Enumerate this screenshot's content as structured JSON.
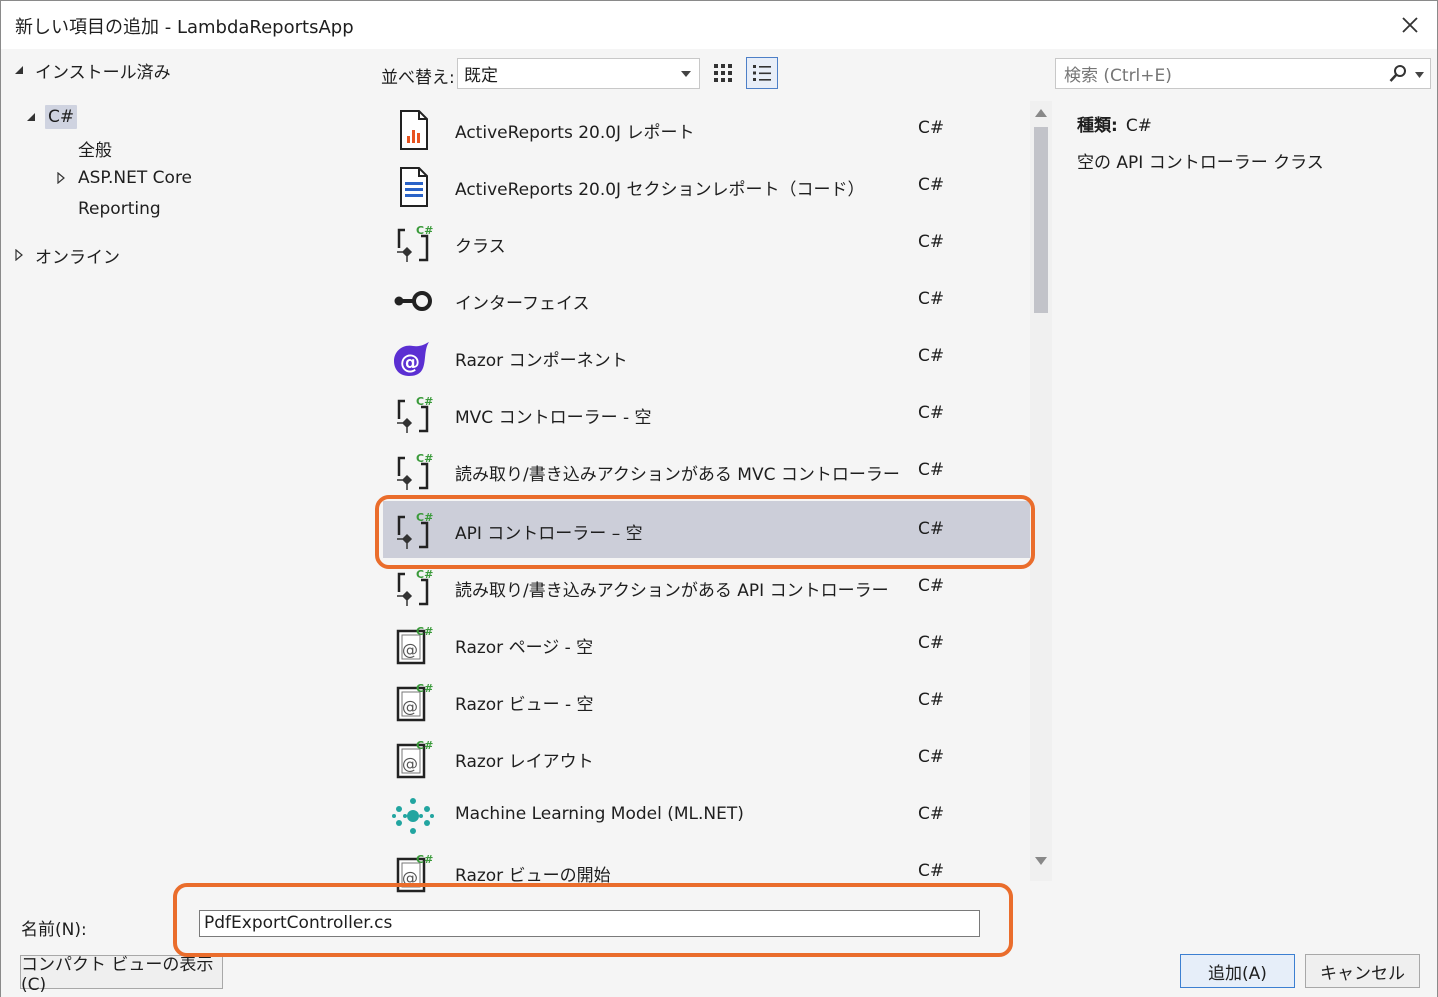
{
  "window": {
    "title": "新しい項目の追加 - LambdaReportsApp"
  },
  "tree": {
    "installed": "インストール済み",
    "csharp": "C#",
    "general": "全般",
    "aspnet": "ASP.NET Core",
    "reporting": "Reporting",
    "online": "オンライン"
  },
  "toolbar": {
    "sort_label": "並べ替え:",
    "sort_value": "既定",
    "search_placeholder": "検索 (Ctrl+E)"
  },
  "items": [
    {
      "label": "ActiveReports 20.0J レポート",
      "lang": "C#",
      "icon": "report-icon"
    },
    {
      "label": "ActiveReports 20.0J セクションレポート（コード）",
      "lang": "C#",
      "icon": "section-report-icon"
    },
    {
      "label": "クラス",
      "lang": "C#",
      "icon": "class-icon"
    },
    {
      "label": "インターフェイス",
      "lang": "C#",
      "icon": "interface-icon"
    },
    {
      "label": "Razor コンポーネント",
      "lang": "C#",
      "icon": "razor-component-icon"
    },
    {
      "label": "MVC コントローラー - 空",
      "lang": "C#",
      "icon": "controller-icon"
    },
    {
      "label": "読み取り/書き込みアクションがある MVC コントローラー",
      "lang": "C#",
      "icon": "controller-icon"
    },
    {
      "label": "API コントローラー – 空",
      "lang": "C#",
      "icon": "controller-icon"
    },
    {
      "label": "読み取り/書き込みアクションがある API コントローラー",
      "lang": "C#",
      "icon": "controller-icon"
    },
    {
      "label": "Razor ページ - 空",
      "lang": "C#",
      "icon": "razor-page-icon"
    },
    {
      "label": "Razor ビュー - 空",
      "lang": "C#",
      "icon": "razor-page-icon"
    },
    {
      "label": "Razor レイアウト",
      "lang": "C#",
      "icon": "razor-page-icon"
    },
    {
      "label": "Machine Learning Model (ML.NET)",
      "lang": "C#",
      "icon": "ml-model-icon"
    },
    {
      "label": "Razor ビューの開始",
      "lang": "C#",
      "icon": "razor-page-icon"
    }
  ],
  "selected_item": "API コントローラー – 空",
  "details": {
    "type_label": "種類:",
    "type_value": "C#",
    "description": "空の API コントローラー クラス"
  },
  "footer": {
    "name_label": "名前(N):",
    "name_value": "PdfExportController.cs",
    "compact_view": "コンパクト ビューの表示(C)",
    "add": "追加(A)",
    "cancel": "キャンセル"
  },
  "colors": {
    "highlight": "#ea6d2c",
    "selected_row": "#ccced9",
    "accent": "#3c7fd1"
  }
}
